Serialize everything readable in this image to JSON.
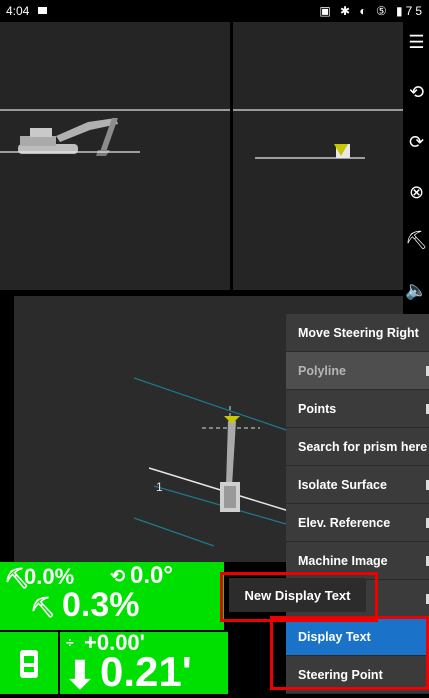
{
  "status_bar": {
    "time": "4:04",
    "right_icons": "▣ ✱ ◐ ⑤ ▮75"
  },
  "views": {
    "front_marker_color": "#c8c800",
    "plan_label": "1"
  },
  "sidebar": {
    "items": [
      {
        "icon": "menu-icon",
        "glyph": "☰"
      },
      {
        "icon": "camera-rotate-icon",
        "glyph": "⟲"
      },
      {
        "icon": "lock-rotate-icon",
        "glyph": "⟳"
      },
      {
        "icon": "close-circle-icon",
        "glyph": "⊗"
      },
      {
        "icon": "excavator-icon",
        "glyph": "⛏"
      },
      {
        "icon": "speaker-icon",
        "glyph": "🔈"
      }
    ]
  },
  "menu": {
    "items": [
      {
        "label": "Move Steering Right",
        "state": "normal",
        "arrow": false
      },
      {
        "label": "Polyline",
        "state": "disabled",
        "arrow": true
      },
      {
        "label": "Points",
        "state": "normal",
        "arrow": true
      },
      {
        "label": "Search for prism here",
        "state": "normal",
        "arrow": false
      },
      {
        "label": "Isolate Surface",
        "state": "normal",
        "arrow": true
      },
      {
        "label": "Elev. Reference",
        "state": "normal",
        "arrow": true
      },
      {
        "label": "Machine Image",
        "state": "normal",
        "arrow": true
      },
      {
        "label": "",
        "state": "normal",
        "arrow": true
      },
      {
        "label": "Display Text",
        "state": "selected",
        "arrow": true
      },
      {
        "label": "Steering Point",
        "state": "normal",
        "arrow": false
      }
    ]
  },
  "tooltip": {
    "label": "New Display Text"
  },
  "readouts": {
    "cross_slope": "0.0%",
    "pitch": "0.0°",
    "main_slope": "0.3%",
    "elevation_offset": "+0.00'",
    "cut_fill": "0.21'"
  },
  "colors": {
    "readout_green": "#00e000",
    "highlight_blue": "#1a73c9",
    "annotation_red": "#e00000"
  }
}
